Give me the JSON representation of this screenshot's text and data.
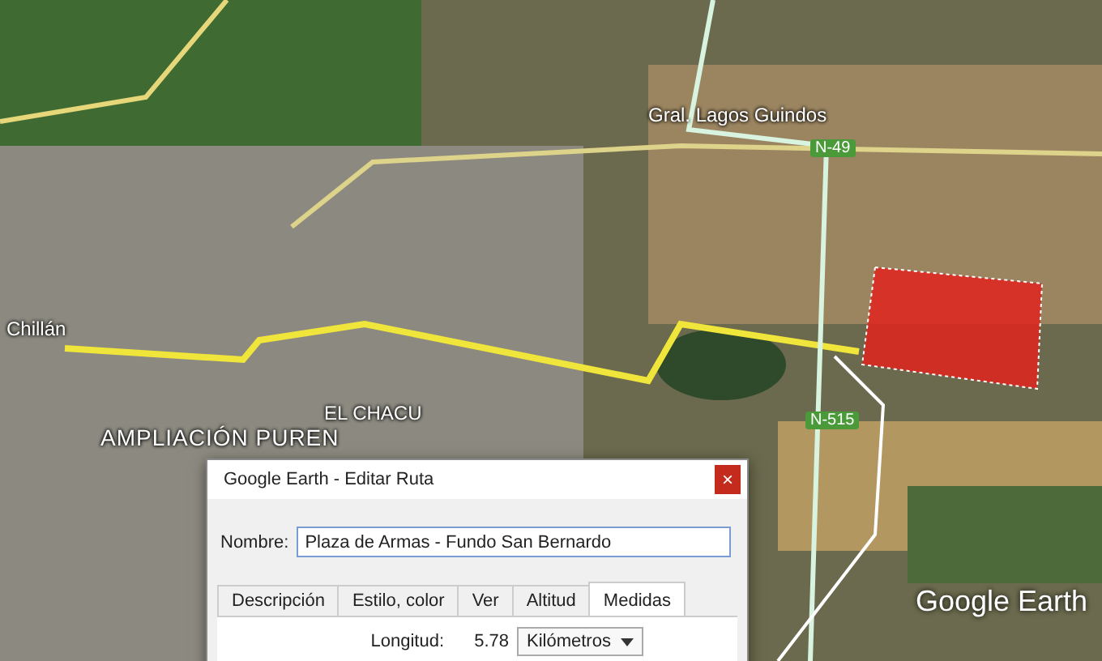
{
  "map": {
    "labels": [
      {
        "kind": "place",
        "text": "Gral. Lagos Guindos"
      },
      {
        "kind": "shield",
        "text": "N-49"
      },
      {
        "kind": "place",
        "text": "Chillán"
      },
      {
        "kind": "place",
        "text": "EL CHACU"
      },
      {
        "kind": "district",
        "text": "AMPLIACIÓN PUREN"
      },
      {
        "kind": "shield",
        "text": "N-515"
      },
      {
        "kind": "logo",
        "text": "Google Earth"
      }
    ]
  },
  "dialog": {
    "title": "Google Earth - Editar Ruta",
    "close": "×",
    "name_label": "Nombre:",
    "name_value": "Plaza de Armas - Fundo San Bernardo",
    "tabs": [
      {
        "label": "Descripción",
        "selected": false
      },
      {
        "label": "Estilo, color",
        "selected": false
      },
      {
        "label": "Ver",
        "selected": false
      },
      {
        "label": "Altitud",
        "selected": false
      },
      {
        "label": "Medidas",
        "selected": true
      }
    ],
    "measure": {
      "label": "Longitud:",
      "value": "5.78",
      "unit": "Kilómetros"
    }
  }
}
